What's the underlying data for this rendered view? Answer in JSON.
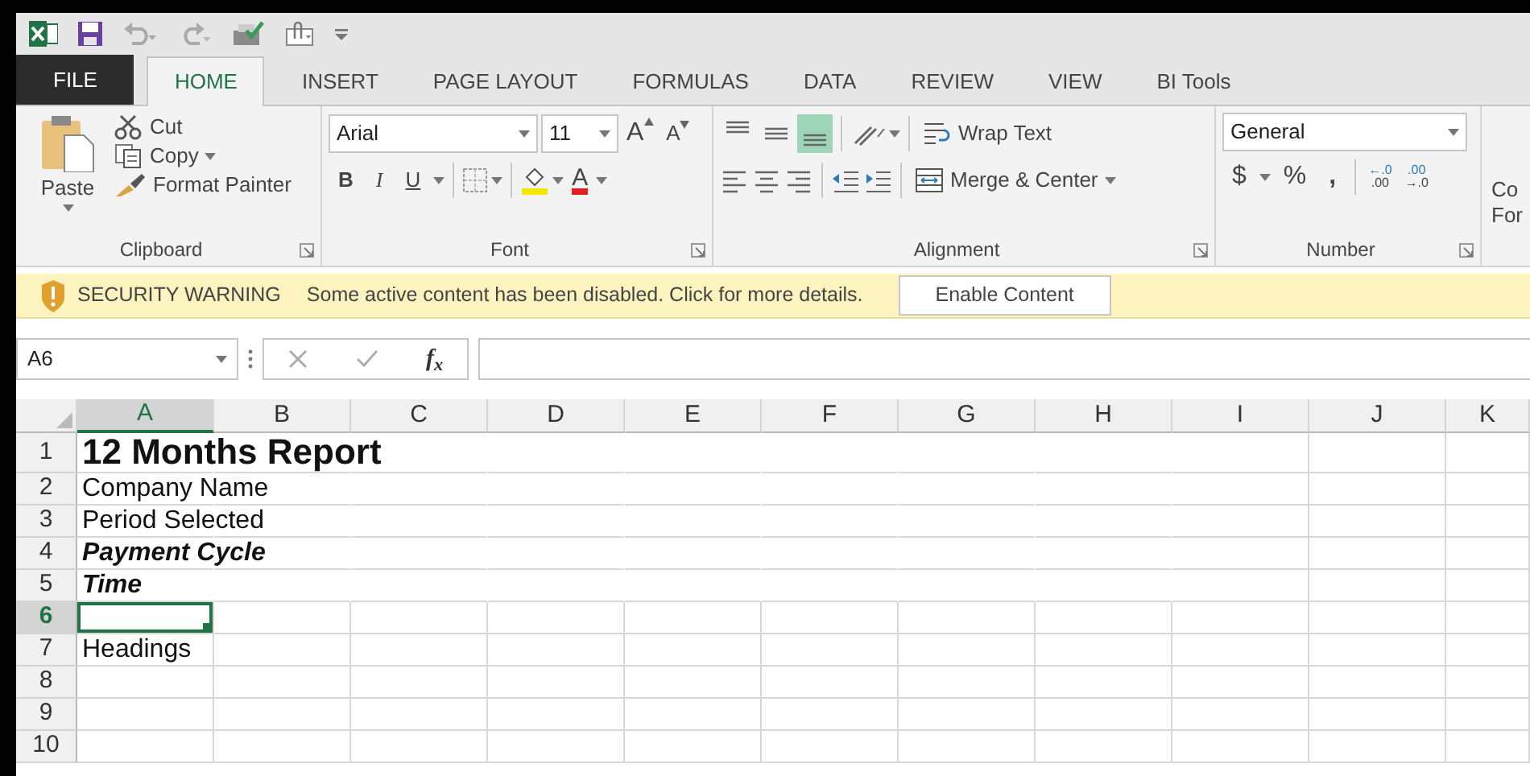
{
  "tabs": [
    {
      "label": "FILE",
      "kind": "file",
      "selected": false
    },
    {
      "label": "HOME",
      "kind": "tab",
      "selected": true
    },
    {
      "label": "INSERT",
      "kind": "tab",
      "selected": false
    },
    {
      "label": "PAGE LAYOUT",
      "kind": "tab",
      "selected": false
    },
    {
      "label": "FORMULAS",
      "kind": "tab",
      "selected": false
    },
    {
      "label": "DATA",
      "kind": "tab",
      "selected": false
    },
    {
      "label": "REVIEW",
      "kind": "tab",
      "selected": false
    },
    {
      "label": "VIEW",
      "kind": "tab",
      "selected": false
    },
    {
      "label": "BI Tools",
      "kind": "tab",
      "selected": false
    }
  ],
  "ribbon": {
    "clipboard": {
      "label": "Clipboard",
      "paste": "Paste",
      "cut": "Cut",
      "copy": "Copy",
      "format_painter": "Format Painter"
    },
    "font": {
      "label": "Font",
      "font_name": "Arial",
      "font_size": "11",
      "grow": "A",
      "shrink": "A",
      "bold": "B",
      "italic": "I",
      "underline": "U",
      "font_color": "A"
    },
    "alignment": {
      "label": "Alignment",
      "vertical": [
        {
          "kind": "top",
          "selected": false
        },
        {
          "kind": "middle",
          "selected": false
        },
        {
          "kind": "bottom",
          "selected": true
        }
      ],
      "wrap_text": "Wrap Text",
      "merge_center": "Merge & Center"
    },
    "number": {
      "label": "Number",
      "format": "General",
      "currency": "$",
      "percent": "%",
      "comma": ",",
      "increase_decimal": [
        "←.0",
        ".00"
      ],
      "decrease_decimal": [
        ".00",
        "→.0"
      ]
    },
    "cut_off_group": [
      "Co",
      "For"
    ]
  },
  "security_bar": {
    "title": "SECURITY WARNING",
    "message": "Some active content has been disabled. Click for more details.",
    "button": "Enable Content"
  },
  "formula_bar": {
    "name_box": "A6",
    "function_label": "f$_{x}$"
  },
  "sheet": {
    "columns": [
      {
        "label": "A",
        "selected": true,
        "filled": true
      },
      {
        "label": "B",
        "selected": false,
        "filled": true
      },
      {
        "label": "C",
        "selected": false,
        "filled": true
      },
      {
        "label": "D",
        "selected": false,
        "filled": true
      },
      {
        "label": "E",
        "selected": false,
        "filled": true
      },
      {
        "label": "F",
        "selected": false,
        "filled": true
      },
      {
        "label": "G",
        "selected": false,
        "filled": true
      },
      {
        "label": "H",
        "selected": false,
        "filled": true
      },
      {
        "label": "I",
        "selected": false,
        "filled": false
      },
      {
        "label": "J",
        "selected": false,
        "filled": false
      },
      {
        "label": "K",
        "selected": false,
        "filled": false
      }
    ],
    "rows": [
      {
        "label": "1",
        "selected": false,
        "filled": true,
        "cell": {
          "text": "12 Months Report",
          "kind": "title"
        }
      },
      {
        "label": "2",
        "selected": false,
        "filled": true,
        "cell": {
          "text": "Company Name",
          "kind": "plain"
        }
      },
      {
        "label": "3",
        "selected": false,
        "filled": true,
        "cell": {
          "text": "Period Selected",
          "kind": "plain"
        }
      },
      {
        "label": "4",
        "selected": false,
        "filled": true,
        "cell": {
          "text": "Payment Cycle",
          "kind": "emphasis"
        }
      },
      {
        "label": "5",
        "selected": false,
        "filled": true,
        "cell": {
          "text": "Time",
          "kind": "emphasis"
        }
      },
      {
        "label": "6",
        "selected": true,
        "filled": false
      },
      {
        "label": "7",
        "selected": false,
        "filled": false,
        "cell": {
          "text": "Headings",
          "kind": "plain"
        }
      },
      {
        "label": "8",
        "selected": false,
        "filled": false
      },
      {
        "label": "9",
        "selected": false,
        "filled": false
      },
      {
        "label": "10",
        "selected": false,
        "filled": false
      }
    ]
  }
}
